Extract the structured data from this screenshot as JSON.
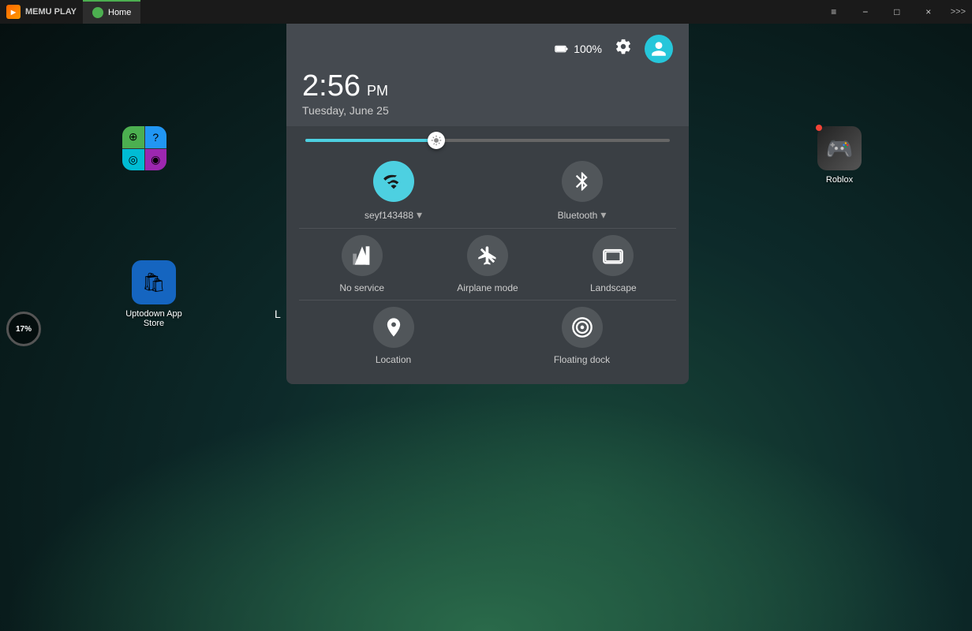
{
  "titleBar": {
    "logo": "MEMU PLAY",
    "tab": {
      "label": "Home"
    },
    "controls": {
      "menu_label": "≡",
      "minimize_label": "−",
      "restore_label": "□",
      "close_label": "×",
      "more_label": ">>>"
    }
  },
  "desktop": {
    "apps_icon_label": "",
    "uptodown_label": "Uptodown App Store",
    "roblox_label": "Roblox",
    "battery_percent": "17%",
    "l_label": "L"
  },
  "quickSettings": {
    "battery": "100%",
    "time": "2:56",
    "ampm": "PM",
    "date": "Tuesday, June 25",
    "brightness": 36,
    "wifi": {
      "label": "seyf143488",
      "active": true
    },
    "bluetooth": {
      "label": "Bluetooth",
      "active": false
    },
    "noService": {
      "label": "No service",
      "active": false
    },
    "airplaneMode": {
      "label": "Airplane mode",
      "active": false
    },
    "landscape": {
      "label": "Landscape",
      "active": false
    },
    "location": {
      "label": "Location",
      "active": false
    },
    "floatingDock": {
      "label": "Floating dock",
      "active": false
    }
  }
}
